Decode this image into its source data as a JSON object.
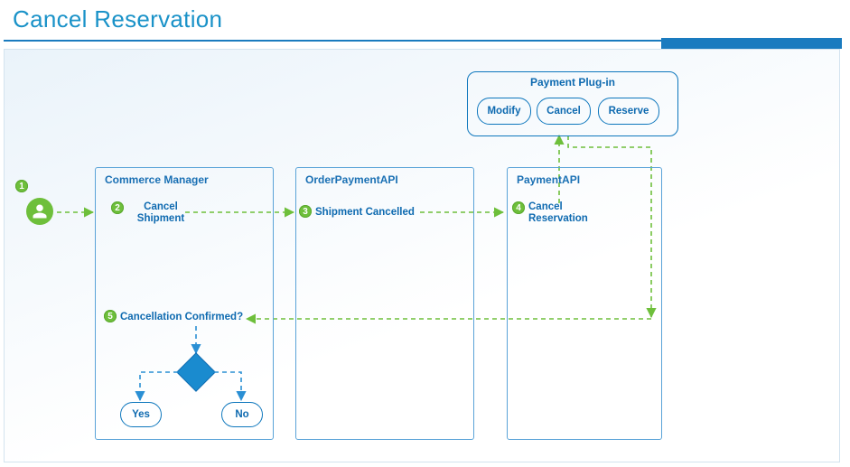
{
  "title": "Cancel Reservation",
  "colors": {
    "accent_blue": "#0e77bd",
    "line_green": "#6ebf3b",
    "line_blue": "#2a8fd4"
  },
  "actor": {
    "name": "User",
    "step": "1"
  },
  "lanes": {
    "commerce": {
      "title": "Commerce Manager"
    },
    "orderapi": {
      "title": "OrderPaymentAPI"
    },
    "paymentapi": {
      "title": "PaymentAPI"
    }
  },
  "plugin": {
    "title": "Payment Plug-in",
    "buttons": {
      "modify": "Modify",
      "cancel": "Cancel",
      "reserve": "Reserve"
    }
  },
  "steps": {
    "s2": {
      "num": "2",
      "label_line1": "Cancel",
      "label_line2": "Shipment"
    },
    "s3": {
      "num": "3",
      "label": "Shipment Cancelled"
    },
    "s4": {
      "num": "4",
      "label_line1": "Cancel",
      "label_line2": "Reservation"
    },
    "s5": {
      "num": "5",
      "label": "Cancellation Confirmed?"
    }
  },
  "decision": {
    "yes": "Yes",
    "no": "No"
  }
}
